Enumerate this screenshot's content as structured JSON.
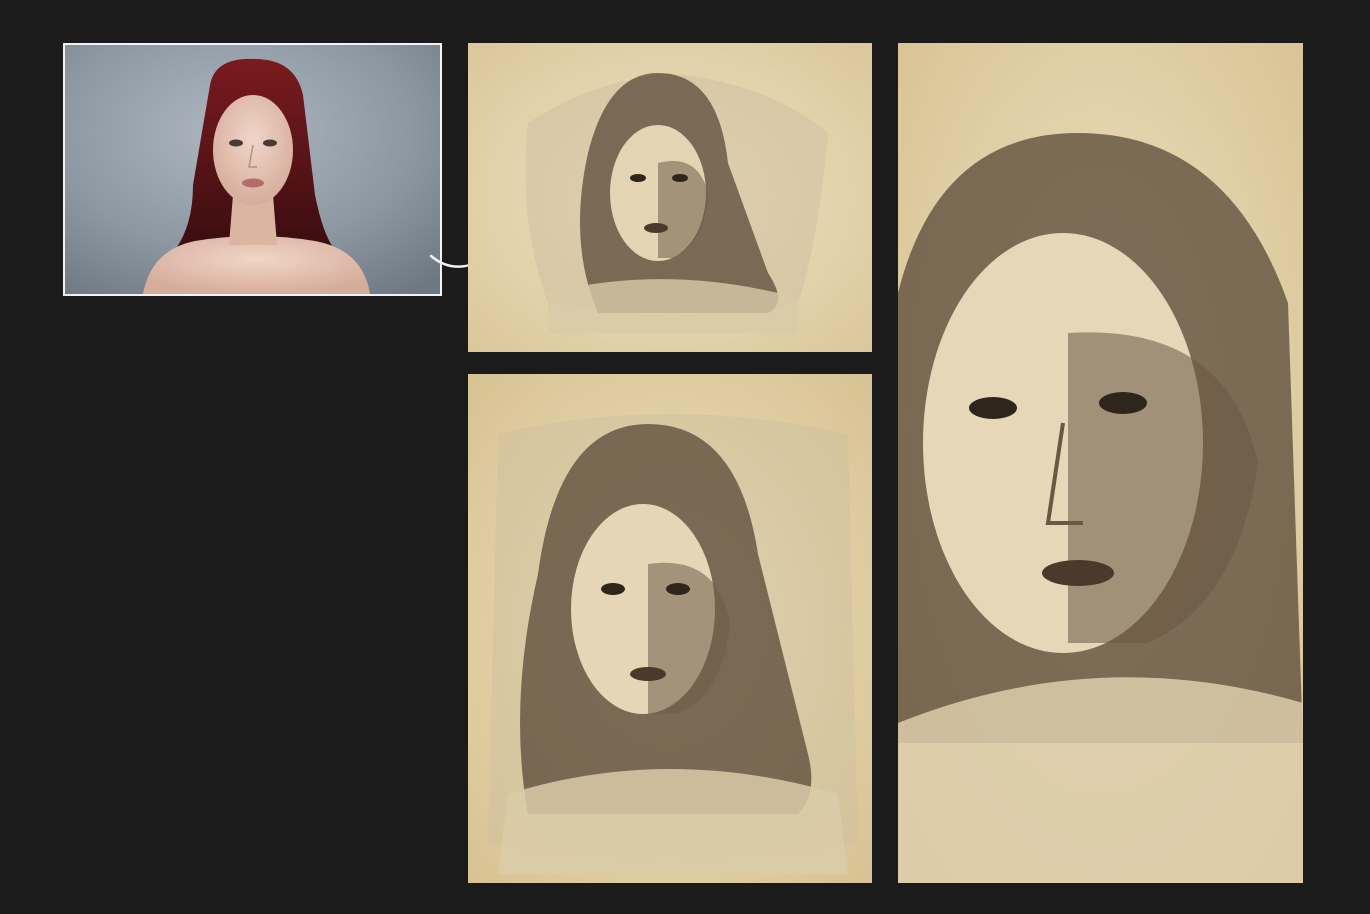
{
  "panels": {
    "original": {
      "icon": "portrait-photo",
      "style": "color photograph"
    },
    "result_top": {
      "icon": "watercolor-portrait",
      "style": "sepia watercolor"
    },
    "result_bottom": {
      "icon": "watercolor-portrait",
      "style": "sepia watercolor"
    },
    "result_tall": {
      "icon": "watercolor-portrait",
      "style": "sepia watercolor"
    }
  },
  "colors": {
    "background": "#1b1b1b",
    "frame": "#f2f2f2",
    "paper": "#e9dcb8",
    "ink": "#4a3d2e"
  }
}
